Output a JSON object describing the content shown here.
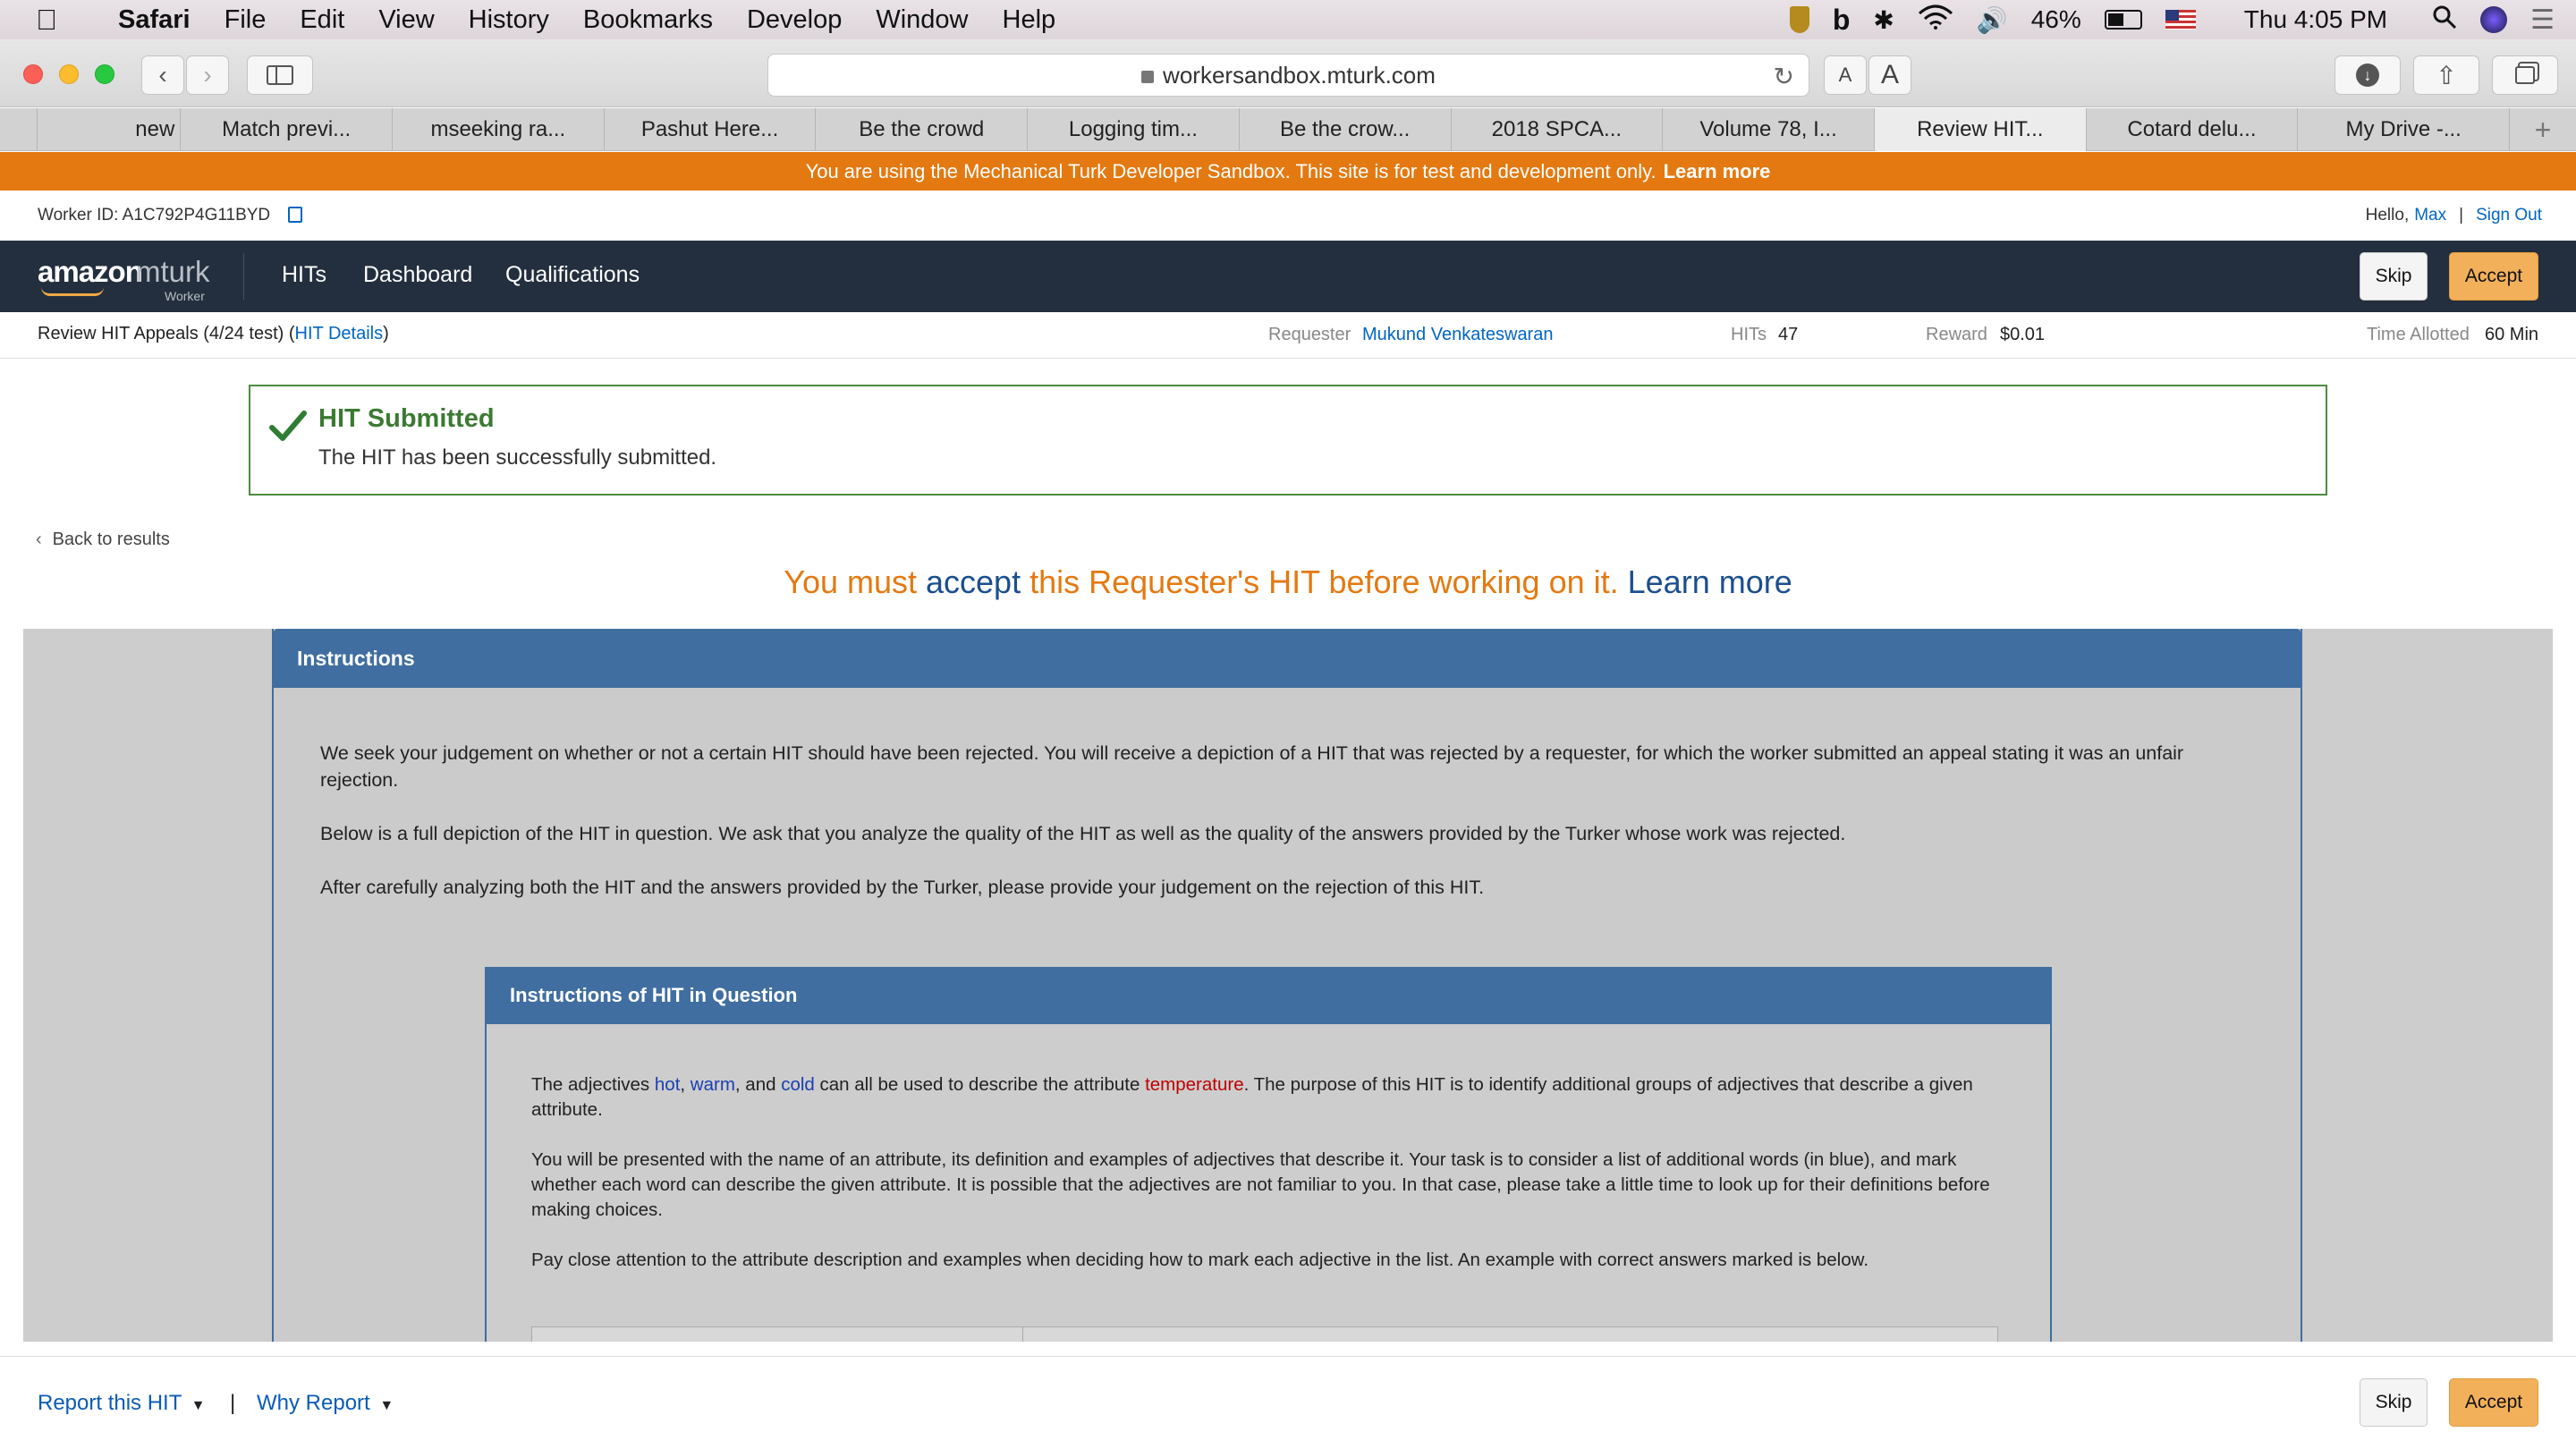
{
  "menubar": {
    "app": "Safari",
    "items": [
      "File",
      "Edit",
      "View",
      "History",
      "Bookmarks",
      "Develop",
      "Window",
      "Help"
    ],
    "battery": "46%",
    "clock": "Thu 4:05 PM"
  },
  "browser": {
    "url": "workersandbox.mturk.com",
    "tabs": [
      "",
      "new",
      "Match previ...",
      "mseeking ra...",
      "Pashut Here...",
      "Be the crowd",
      "Logging tim...",
      "Be the crow...",
      "2018 SPCA...",
      "Volume 78, I...",
      "Review HIT...",
      "Cotard delu...",
      "My Drive -..."
    ],
    "active_tab_index": 10,
    "text_small": "A",
    "text_large": "A"
  },
  "banner": {
    "text": "You are using the Mechanical Turk Developer Sandbox. This site is for test and development only.",
    "link": "Learn more"
  },
  "worker": {
    "id_text": "Worker ID: A1C792P4G11BYD",
    "hello": "Hello,",
    "name": "Max",
    "separator": "|",
    "signout": "Sign Out"
  },
  "nav": {
    "logo_main": "amazon",
    "logo_accent": "mturk",
    "logo_sub": "Worker",
    "links": [
      "HITs",
      "Dashboard",
      "Qualifications"
    ],
    "skip": "Skip",
    "accept": "Accept"
  },
  "hitinfo": {
    "title": "Review HIT Appeals (4/24 test)",
    "details_link": "HIT Details",
    "requester_label": "Requester",
    "requester": "Mukund Venkateswaran",
    "hits_label": "HITs",
    "hits": "47",
    "reward_label": "Reward",
    "reward": "$0.01",
    "time_label": "Time Allotted",
    "time": "60 Min"
  },
  "alert": {
    "title": "HIT Submitted",
    "message": "The HIT has been successfully submitted."
  },
  "back": "Back to results",
  "must_accept": {
    "pre": "You must",
    "accept": "accept",
    "mid": "this Requester's HIT before working on it.",
    "learn": "Learn more"
  },
  "instructions": {
    "heading": "Instructions",
    "p1": "We seek your judgement on whether or not a certain HIT should have been rejected. You will receive a depiction of a HIT that was rejected by a requester, for which the worker submitted an appeal stating it was an unfair rejection.",
    "p2": "Below is a full depiction of the HIT in question. We ask that you analyze the quality of the HIT as well as the quality of the answers provided by the Turker whose work was rejected.",
    "p3": "After carefully analyzing both the HIT and the answers provided by the Turker, please provide your judgement on the rejection of this HIT."
  },
  "inner": {
    "heading": "Instructions of HIT in Question",
    "p1_a": "The adjectives",
    "w_hot": "hot",
    "c1": ",",
    "w_warm": "warm",
    "c2": ", and",
    "w_cold": "cold",
    "p1_b": "can all be used to describe the attribute",
    "w_temp": "temperature",
    "p1_c": ". The purpose of this HIT is to identify additional groups of adjectives that describe a given attribute.",
    "p2": "You will be presented with the name of an attribute, its definition and examples of adjectives that describe it. Your task is to consider a list of additional words (in blue), and mark whether each word can describe the given attribute. It is possible that the adjectives are not familiar to you. In that case, please take a little time to look up for their definitions before making choices.",
    "p3": "Pay close attention to the attribute description and examples when deciding how to mark each adjective in the list. An example with correct answers marked is below."
  },
  "footer": {
    "report": "Report this HIT",
    "sep": "|",
    "why": "Why Report",
    "skip": "Skip",
    "accept": "Accept"
  },
  "colors": {
    "sandbox_orange": "#e47911",
    "nav_bg": "#232f3e",
    "accept_btn": "#f3b05a",
    "panel_blue": "#406ea0",
    "success_green": "#4c8c3f",
    "link_blue": "#0066c0"
  },
  "icons": [
    "apple-icon",
    "lock-icon",
    "reload-icon",
    "download-icon",
    "share-icon",
    "tabs-icon",
    "sidebar-icon",
    "check-icon",
    "copy-icon",
    "caret-down-icon",
    "chevron-left-icon"
  ]
}
